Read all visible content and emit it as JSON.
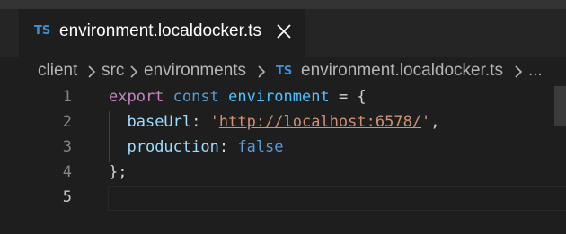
{
  "tab": {
    "lang_badge": "TS",
    "title": "environment.localdocker.ts",
    "close_glyph": "close-icon"
  },
  "breadcrumb": {
    "items": [
      "client",
      "src",
      "environments",
      "environment.localdocker.ts",
      "..."
    ],
    "lang_badge": "TS"
  },
  "editor": {
    "line_numbers": [
      "1",
      "2",
      "3",
      "4",
      "5"
    ],
    "active_line": "5",
    "lines": [
      {
        "export": "export",
        "const": "const",
        "name": "environment",
        "eq": " = {"
      },
      {
        "key": "baseUrl",
        "colon": ": ",
        "q1": "'",
        "url": "http://localhost:6578/",
        "q2": "'",
        "end": ","
      },
      {
        "key": "production",
        "colon": ": ",
        "value": "false"
      },
      {
        "close": "};"
      },
      {
        "text": ""
      }
    ]
  },
  "colors": {
    "background": "#1e1e1e",
    "tabbar": "#252526",
    "ts_badge": "#3d8fd6",
    "keyword": "#c586c0",
    "storage": "#569cd6",
    "variable": "#4fc1ff",
    "property": "#9cdcfe",
    "string": "#ce9178"
  }
}
